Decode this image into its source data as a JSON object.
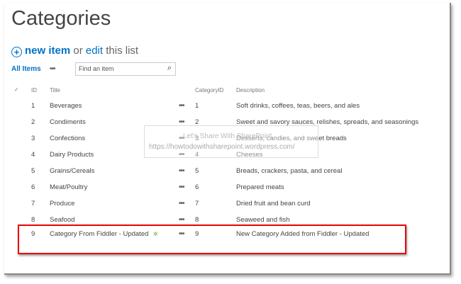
{
  "page_title": "Categories",
  "command": {
    "new_item": "new item",
    "or": "or",
    "edit": "edit",
    "this_list": "this list"
  },
  "view": {
    "all_items": "All Items",
    "more": "•••",
    "search_placeholder": "Find an item"
  },
  "columns": {
    "check": "✓",
    "id": "ID",
    "title": "Title",
    "category_id": "CategoryID",
    "description": "Description"
  },
  "rows": [
    {
      "id": "1",
      "title": "Beverages",
      "category_id": "1",
      "description": "Soft drinks, coffees, teas, beers, and ales"
    },
    {
      "id": "2",
      "title": "Condiments",
      "category_id": "2",
      "description": "Sweet and savory sauces, relishes, spreads, and seasonings"
    },
    {
      "id": "3",
      "title": "Confections",
      "category_id": "3",
      "description": "Desserts, candies, and sweet breads"
    },
    {
      "id": "4",
      "title": "Dairy Products",
      "category_id": "4",
      "description": "Cheeses"
    },
    {
      "id": "5",
      "title": "Grains/Cereals",
      "category_id": "5",
      "description": "Breads, crackers, pasta, and cereal"
    },
    {
      "id": "6",
      "title": "Meat/Poultry",
      "category_id": "6",
      "description": "Prepared meats"
    },
    {
      "id": "7",
      "title": "Produce",
      "category_id": "7",
      "description": "Dried fruit and bean curd"
    },
    {
      "id": "8",
      "title": "Seafood",
      "category_id": "8",
      "description": "Seaweed and fish"
    },
    {
      "id": "9",
      "title": "Category From Fiddler - Updated",
      "category_id": "9",
      "description": "New Category Added from Fiddler - Updated"
    }
  ],
  "row_menu": "•••",
  "new_badge": "✲",
  "watermark": {
    "line1": "Let's Share With SharePoint",
    "line2": "https://howtodowithsharepoint.wordpress.com/"
  }
}
